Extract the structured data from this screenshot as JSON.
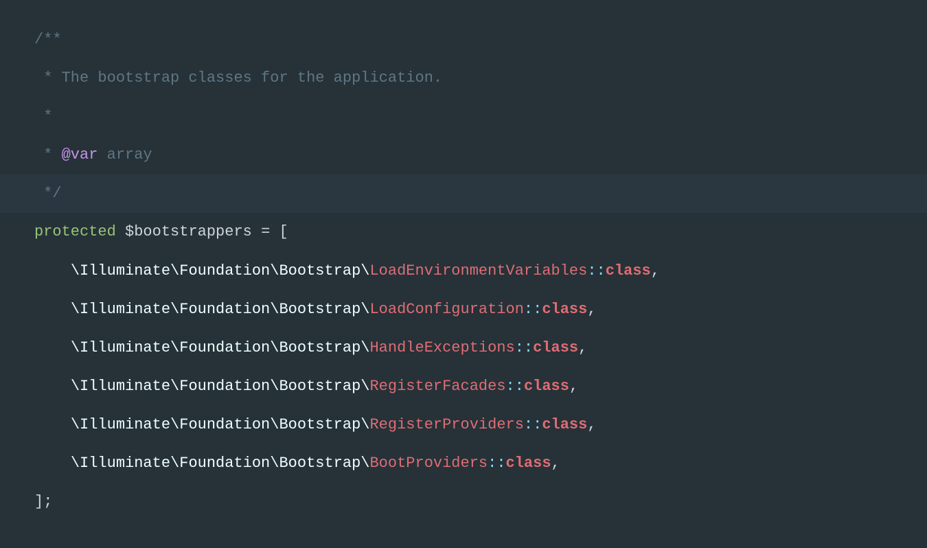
{
  "docblock": {
    "open": "/**",
    "description": " * The bootstrap classes for the application.",
    "empty": " *",
    "var_prefix": " * ",
    "var_tag": "@var",
    "var_type": " array",
    "close": " */"
  },
  "declaration": {
    "keyword": "protected",
    "variable": "$bootstrappers",
    "equals": " = ",
    "open_bracket": "["
  },
  "namespace_prefix": "\\Illuminate\\Foundation\\Bootstrap\\",
  "doublecolon": "::",
  "class_kw": "class",
  "comma": ",",
  "items": [
    "LoadEnvironmentVariables",
    "LoadConfiguration",
    "HandleExceptions",
    "RegisterFacades",
    "RegisterProviders",
    "BootProviders"
  ],
  "close_bracket": "];",
  "indent1": "",
  "indent2": "    "
}
